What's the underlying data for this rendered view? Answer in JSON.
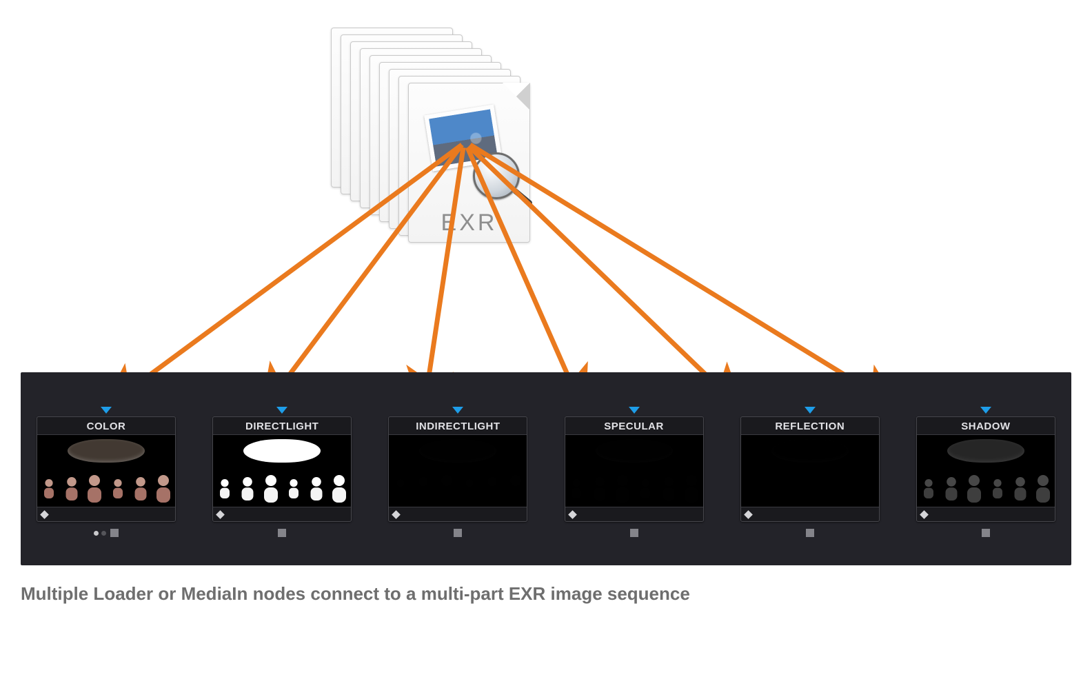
{
  "file": {
    "format_label": "EXR",
    "icon_description": "photo-with-magnifier"
  },
  "arrow_color": "#ea7a1e",
  "panel_bg": "#232329",
  "nodes": [
    {
      "label": "COLOR",
      "dome": "#4a4038",
      "head": "#d8a99a",
      "body": "#b97f73",
      "brightness": 0.9
    },
    {
      "label": "DIRECTLIGHT",
      "dome": "#ffffff",
      "head": "#ffffff",
      "body": "#f4f4f4",
      "brightness": 1.0
    },
    {
      "label": "INDIRECTLIGHT",
      "dome": "#141414",
      "head": "#1a1a1a",
      "body": "#121212",
      "brightness": 0.05
    },
    {
      "label": "SPECULAR",
      "dome": "#101010",
      "head": "#1c1c1c",
      "body": "#141414",
      "brightness": 0.06
    },
    {
      "label": "REFLECTION",
      "dome": "#0e0e0e",
      "head": "#141414",
      "body": "#101010",
      "brightness": 0.04
    },
    {
      "label": "SHADOW",
      "dome": "#565656",
      "head": "#9d9d9d",
      "body": "#8a8a8a",
      "brightness": 0.45
    }
  ],
  "caption": "Multiple Loader or MediaIn nodes connect to a multi-part EXR image sequence"
}
